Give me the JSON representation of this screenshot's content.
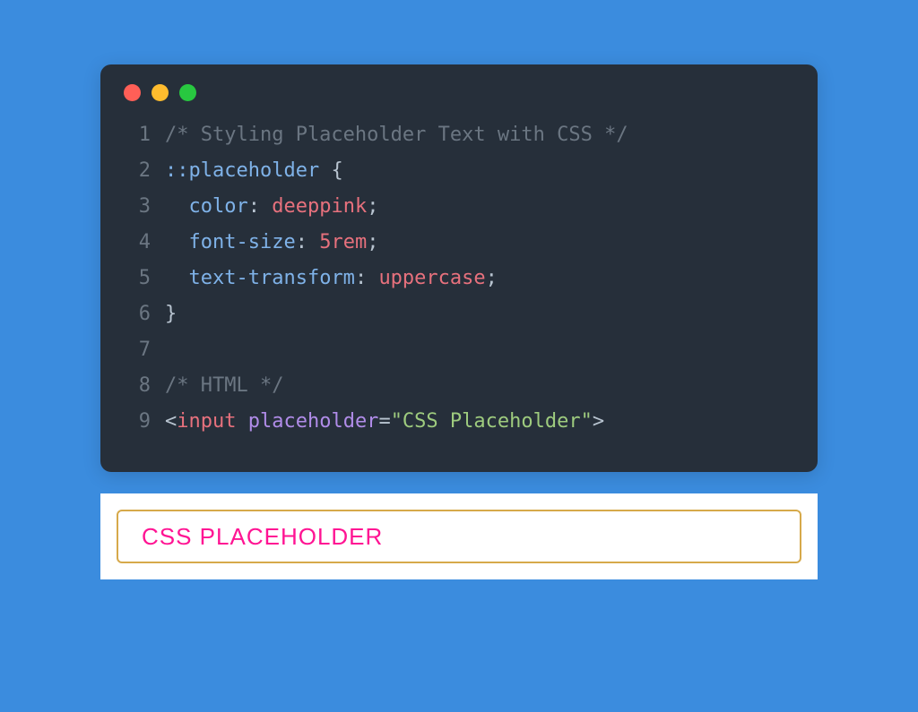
{
  "editor": {
    "lines": [
      {
        "n": "1",
        "segments": [
          {
            "cls": "tok-comment",
            "t": "/* Styling Placeholder Text with CSS */"
          }
        ]
      },
      {
        "n": "2",
        "segments": [
          {
            "cls": "tok-selector",
            "t": "::"
          },
          {
            "cls": "tok-pseudo",
            "t": "placeholder "
          },
          {
            "cls": "tok-brace",
            "t": "{"
          }
        ]
      },
      {
        "n": "3",
        "segments": [
          {
            "cls": "",
            "t": "  "
          },
          {
            "cls": "tok-prop",
            "t": "color"
          },
          {
            "cls": "tok-colon",
            "t": ": "
          },
          {
            "cls": "tok-kw",
            "t": "deeppink"
          },
          {
            "cls": "tok-semi",
            "t": ";"
          }
        ]
      },
      {
        "n": "4",
        "segments": [
          {
            "cls": "",
            "t": "  "
          },
          {
            "cls": "tok-prop",
            "t": "font-size"
          },
          {
            "cls": "tok-colon",
            "t": ": "
          },
          {
            "cls": "tok-number",
            "t": "5"
          },
          {
            "cls": "tok-unit",
            "t": "rem"
          },
          {
            "cls": "tok-semi",
            "t": ";"
          }
        ]
      },
      {
        "n": "5",
        "segments": [
          {
            "cls": "",
            "t": "  "
          },
          {
            "cls": "tok-prop",
            "t": "text-transform"
          },
          {
            "cls": "tok-colon",
            "t": ": "
          },
          {
            "cls": "tok-kw",
            "t": "uppercase"
          },
          {
            "cls": "tok-semi",
            "t": ";"
          }
        ]
      },
      {
        "n": "6",
        "segments": [
          {
            "cls": "tok-brace",
            "t": "}"
          }
        ]
      },
      {
        "n": "7",
        "segments": [
          {
            "cls": "",
            "t": ""
          }
        ]
      },
      {
        "n": "8",
        "segments": [
          {
            "cls": "tok-comment",
            "t": "/* HTML */"
          }
        ]
      },
      {
        "n": "9",
        "segments": [
          {
            "cls": "tok-angle",
            "t": "<"
          },
          {
            "cls": "tok-tag",
            "t": "input "
          },
          {
            "cls": "tok-attr",
            "t": "placeholder"
          },
          {
            "cls": "tok-eq",
            "t": "="
          },
          {
            "cls": "tok-string",
            "t": "\"CSS Placeholder\""
          },
          {
            "cls": "tok-angle",
            "t": ">"
          }
        ]
      }
    ]
  },
  "preview": {
    "placeholder": "CSS Placeholder"
  },
  "colors": {
    "page_bg": "#3b8cde",
    "editor_bg": "#262f3a",
    "border": "#d6a94a",
    "placeholder": "#ff1493"
  }
}
